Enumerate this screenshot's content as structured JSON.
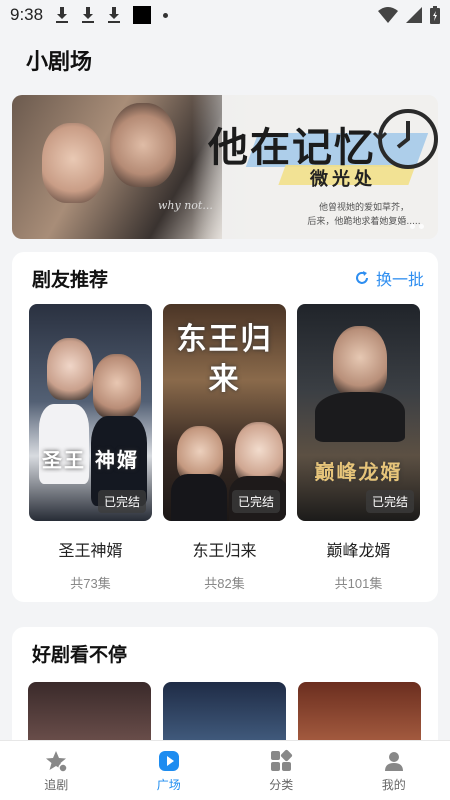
{
  "status_bar": {
    "time": "9:38",
    "icons": [
      "download-icon",
      "download-icon",
      "download-icon",
      "notification-square-icon",
      "dot-icon",
      "wifi-icon",
      "signal-icon",
      "battery-icon"
    ]
  },
  "page": {
    "title": "小剧场"
  },
  "banner": {
    "title": "他在记忆",
    "subtitle": "微光处",
    "caption_line1": "他曾视她的爱如草芥，",
    "caption_line2": "后来，他跪地求着她复婚.....",
    "script_text": "why not..."
  },
  "recommend": {
    "title": "剧友推荐",
    "refresh_label": "换一批",
    "items": [
      {
        "name": "圣王神婿",
        "episodes": "共73集",
        "status": "已完结",
        "poster_text": "圣王 神婿"
      },
      {
        "name": "东王归来",
        "episodes": "共82集",
        "status": "已完结",
        "poster_text": "东王归来"
      },
      {
        "name": "巅峰龙婿",
        "episodes": "共101集",
        "status": "已完结",
        "poster_text": "巅峰龙婿"
      }
    ]
  },
  "more": {
    "title": "好剧看不停"
  },
  "tabbar": {
    "active": "广场",
    "items": [
      {
        "label": "追剧",
        "icon": "star-icon"
      },
      {
        "label": "广场",
        "icon": "play-icon"
      },
      {
        "label": "分类",
        "icon": "category-icon"
      },
      {
        "label": "我的",
        "icon": "user-icon"
      }
    ]
  },
  "colors": {
    "accent": "#1d8cf0",
    "background": "#f3f4f6",
    "card": "#ffffff"
  }
}
